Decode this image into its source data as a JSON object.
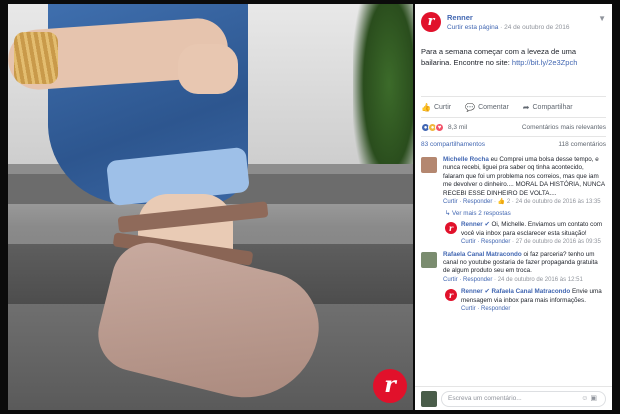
{
  "post": {
    "page_name": "Renner",
    "like_page": "Curtir esta página",
    "date": "24 de outubro de 2016",
    "text": "Para a semana começar com a leveza de uma bailarina. Encontre no site:",
    "link": "http://bit.ly/2e3Zpch"
  },
  "actions": {
    "like": "Curtir",
    "comment": "Comentar",
    "share": "Compartilhar"
  },
  "reactions": {
    "count": "8,3 mil",
    "sort": "Comentários mais relevantes"
  },
  "stats": {
    "shares": "83 compartilhamentos",
    "comments": "118 comentários"
  },
  "comments": [
    {
      "name": "Michelle Rocha",
      "text": "eu Comprei uma bolsa desse tempo, e nunca recebi, liguei pra saber oq tinha acontecido, falaram que foi um problema nos correios, mas que iam me devolver o dinheiro.... MORAL DA HISTÓRIA, NUNCA RECEBI ESSE DINHEIRO DE VOLTA....",
      "reply": "Curtir · Responder",
      "likes": "2",
      "date": "24 de outubro de 2016 às 13:35"
    },
    {
      "more": "Ver mais 2 respostas"
    },
    {
      "name": "Renner",
      "text": "Oi, Michelle. Enviamos um contato com você via inbox para esclarecer esta situação!",
      "reply": "Curtir · Responder",
      "date": "27 de outubro de 2016 às 09:35"
    },
    {
      "name": "Rafaela Canal Matracondo",
      "text": "oi faz parceria? tenho um canal no youtube gostaria de fazer propaganda gratuita de algum produto seu em troca.",
      "reply": "Curtir · Responder",
      "date": "24 de outubro de 2016 às 12:51"
    },
    {
      "name": "Renner",
      "mention": "Rafaela Canal Matracondo",
      "text": "Envie uma mensagem via inbox para mais informações.",
      "reply": "Curtir · Responder"
    }
  ],
  "composer": {
    "placeholder": "Escreva um comentário..."
  },
  "colors": {
    "brand": "#e1112b",
    "link": "#4267b2"
  }
}
